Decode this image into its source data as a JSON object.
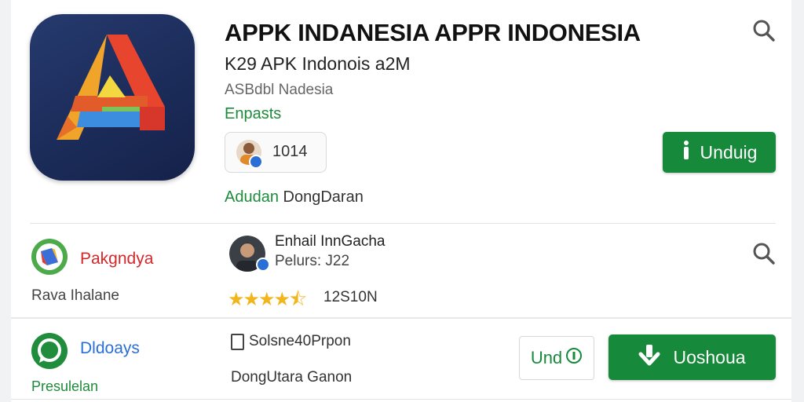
{
  "app": {
    "title": "APPK INDANESIA APPR INDONESIA",
    "subtitle": "K29 APK Indonois a2M",
    "developer": "ASBdbl Nadesia",
    "category": "Enpasts",
    "chip_text": "1014",
    "update_label": "Adudan",
    "update_value": "DongDaran",
    "download_label": "Unduig"
  },
  "row2": {
    "left_title": "Pakgndya",
    "left_subtitle": "Rava Ihalane",
    "name": "Enhail InnGacha",
    "subname": "Pelurs: J22",
    "stars": "★★★★",
    "rating_count": "12S10N"
  },
  "row3": {
    "left_title": "Dldoays",
    "left_subtitle": "Presulelan",
    "option_label": "Solsne40Prpon",
    "caption": "DongUtara Ganon",
    "outline_button": "Und",
    "green_button": "Uoshoua"
  },
  "colors": {
    "brand_green": "#168a3a",
    "green_text": "#1e8b3b",
    "star": "#f2b51c",
    "red_text": "#d6262a",
    "blue_text": "#2a6fd6"
  },
  "icons": [
    "search-icon",
    "info-icon",
    "download-icon",
    "app-logo-icon",
    "whatsapp-icon",
    "checkbox-icon"
  ]
}
